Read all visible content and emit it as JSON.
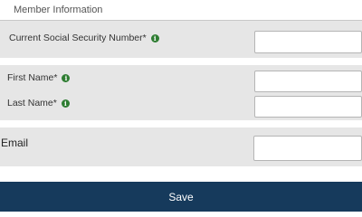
{
  "section": {
    "title": "Member Information"
  },
  "fields": {
    "ssn": {
      "label": "Current Social Security Number*",
      "value": "",
      "info_icon": "info-icon"
    },
    "first_name": {
      "label": "First Name*",
      "value": "",
      "info_icon": "info-icon"
    },
    "last_name": {
      "label": "Last Name*",
      "value": "",
      "info_icon": "info-icon"
    },
    "email": {
      "label": "Email",
      "value": ""
    }
  },
  "actions": {
    "save_label": "Save"
  },
  "colors": {
    "band_bg": "#e6e6e6",
    "save_bg": "#163a5c",
    "info_icon": "#2e7d32"
  }
}
